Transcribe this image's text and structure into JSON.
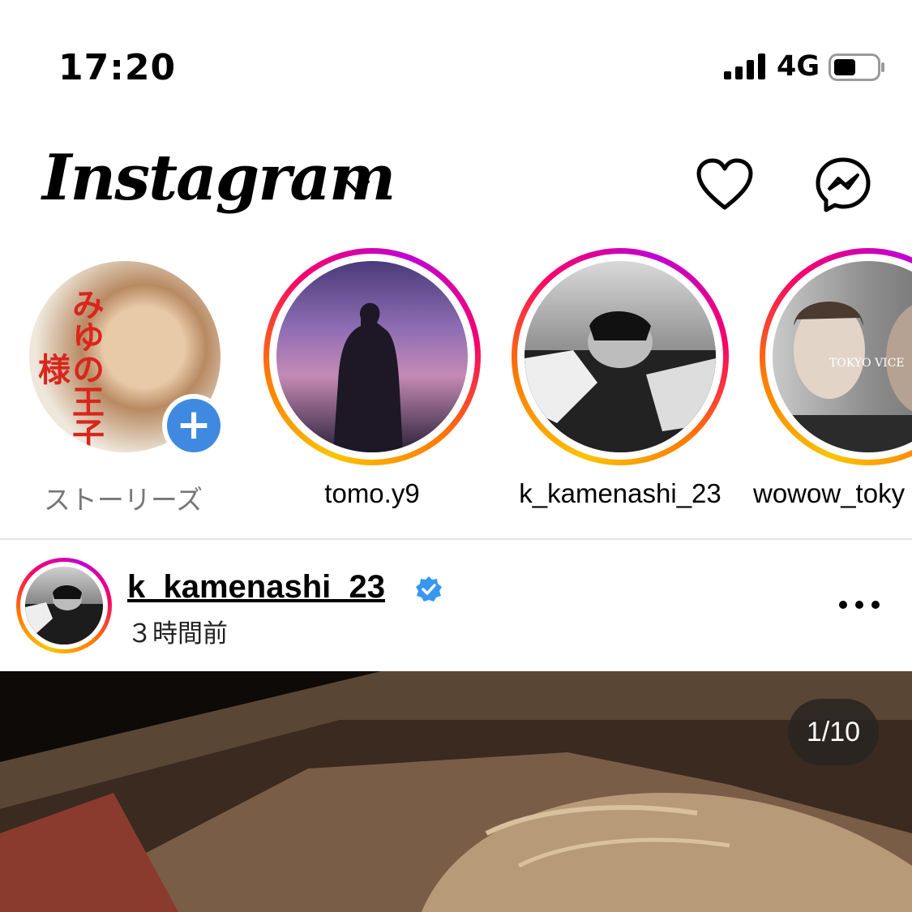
{
  "status_bar": {
    "time": "17:20",
    "network": "4G"
  },
  "header": {
    "logo": "Instagram",
    "icons": [
      "chevron-down-icon",
      "heart-icon",
      "messenger-icon"
    ]
  },
  "stories": [
    {
      "label": "ストーリーズ",
      "avatar_text": "みゆの王子様",
      "own": true,
      "label_color": "#777777"
    },
    {
      "label": "tomo.y9",
      "own": false
    },
    {
      "label": "k_kamenashi_23",
      "own": false
    },
    {
      "label": "wowow_toky",
      "own": false,
      "avatar_text": "TOKYO VICE"
    }
  ],
  "post": {
    "username": "k_kamenashi_23",
    "verified": true,
    "time": "３時間前",
    "page_counter": "1/10"
  },
  "colors": {
    "story_ring_gradient": [
      "#f9c400",
      "#ff7a00",
      "#f5006d",
      "#c000d5"
    ],
    "add_story_blue": "#3f8ae0",
    "verified_blue": "#3897f0"
  }
}
